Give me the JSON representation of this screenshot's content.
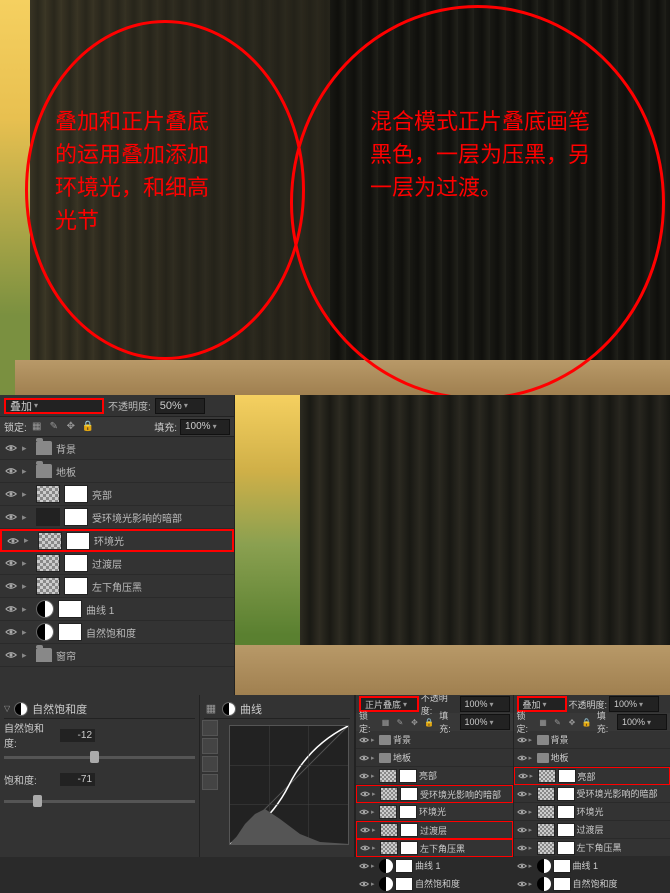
{
  "annotations": {
    "circle1_text": "叠加和正片叠底的运用叠加添加环境光，和细高光节",
    "circle2_text": "混合模式正片叠底画笔黑色，一层为压黑，另一层为过渡。"
  },
  "main_panel": {
    "blend_mode": "叠加",
    "opacity_label": "不透明度:",
    "opacity_value": "50%",
    "lock_label": "锁定:",
    "fill_label": "填充:",
    "fill_value": "100%",
    "layers": [
      {
        "name": "背景",
        "type": "group"
      },
      {
        "name": "地板",
        "type": "group"
      },
      {
        "name": "亮部",
        "type": "layer",
        "checker": true,
        "mask": true
      },
      {
        "name": "受环境光影响的暗部",
        "type": "layer",
        "dark": true,
        "mask": true
      },
      {
        "name": "环境光",
        "type": "layer",
        "checker": true,
        "mask": true,
        "highlighted": true
      },
      {
        "name": "过渡层",
        "type": "layer",
        "checker": true,
        "mask": true
      },
      {
        "name": "左下角压黑",
        "type": "layer",
        "checker": true,
        "mask": true
      },
      {
        "name": "曲线 1",
        "type": "adjustment"
      },
      {
        "name": "自然饱和度",
        "type": "adjustment"
      },
      {
        "name": "窗帘",
        "type": "group",
        "dark": true
      }
    ]
  },
  "vibrance": {
    "title": "自然饱和度",
    "vibrance_label": "自然饱和度:",
    "vibrance_value": "-12",
    "saturation_label": "饱和度:",
    "saturation_value": "-71"
  },
  "curves": {
    "title": "曲线"
  },
  "panel_left": {
    "blend_mode": "正片叠底",
    "opacity_label": "不透明度:",
    "opacity_value": "100%",
    "lock_label": "锁定:",
    "fill_label": "填充:",
    "fill_value": "100%",
    "layers": [
      {
        "name": "背景",
        "type": "group"
      },
      {
        "name": "地板",
        "type": "group"
      },
      {
        "name": "亮部",
        "type": "layer"
      },
      {
        "name": "受环境光影响的暗部",
        "type": "layer",
        "highlighted": true
      },
      {
        "name": "环境光",
        "type": "layer"
      },
      {
        "name": "过渡层",
        "type": "layer",
        "highlighted": true
      },
      {
        "name": "左下角压黑",
        "type": "layer",
        "highlighted": true
      },
      {
        "name": "曲线 1",
        "type": "adjustment"
      },
      {
        "name": "自然饱和度",
        "type": "adjustment"
      }
    ]
  },
  "panel_right": {
    "blend_mode": "叠加",
    "opacity_label": "不透明度:",
    "opacity_value": "100%",
    "lock_label": "锁定:",
    "fill_label": "填充:",
    "fill_value": "100%",
    "layers": [
      {
        "name": "背景",
        "type": "group"
      },
      {
        "name": "地板",
        "type": "group"
      },
      {
        "name": "亮部",
        "type": "layer",
        "highlighted": true
      },
      {
        "name": "受环境光影响的暗部",
        "type": "layer"
      },
      {
        "name": "环境光",
        "type": "layer"
      },
      {
        "name": "过渡层",
        "type": "layer"
      },
      {
        "name": "左下角压黑",
        "type": "layer"
      },
      {
        "name": "曲线 1",
        "type": "adjustment"
      },
      {
        "name": "自然饱和度",
        "type": "adjustment"
      }
    ]
  }
}
